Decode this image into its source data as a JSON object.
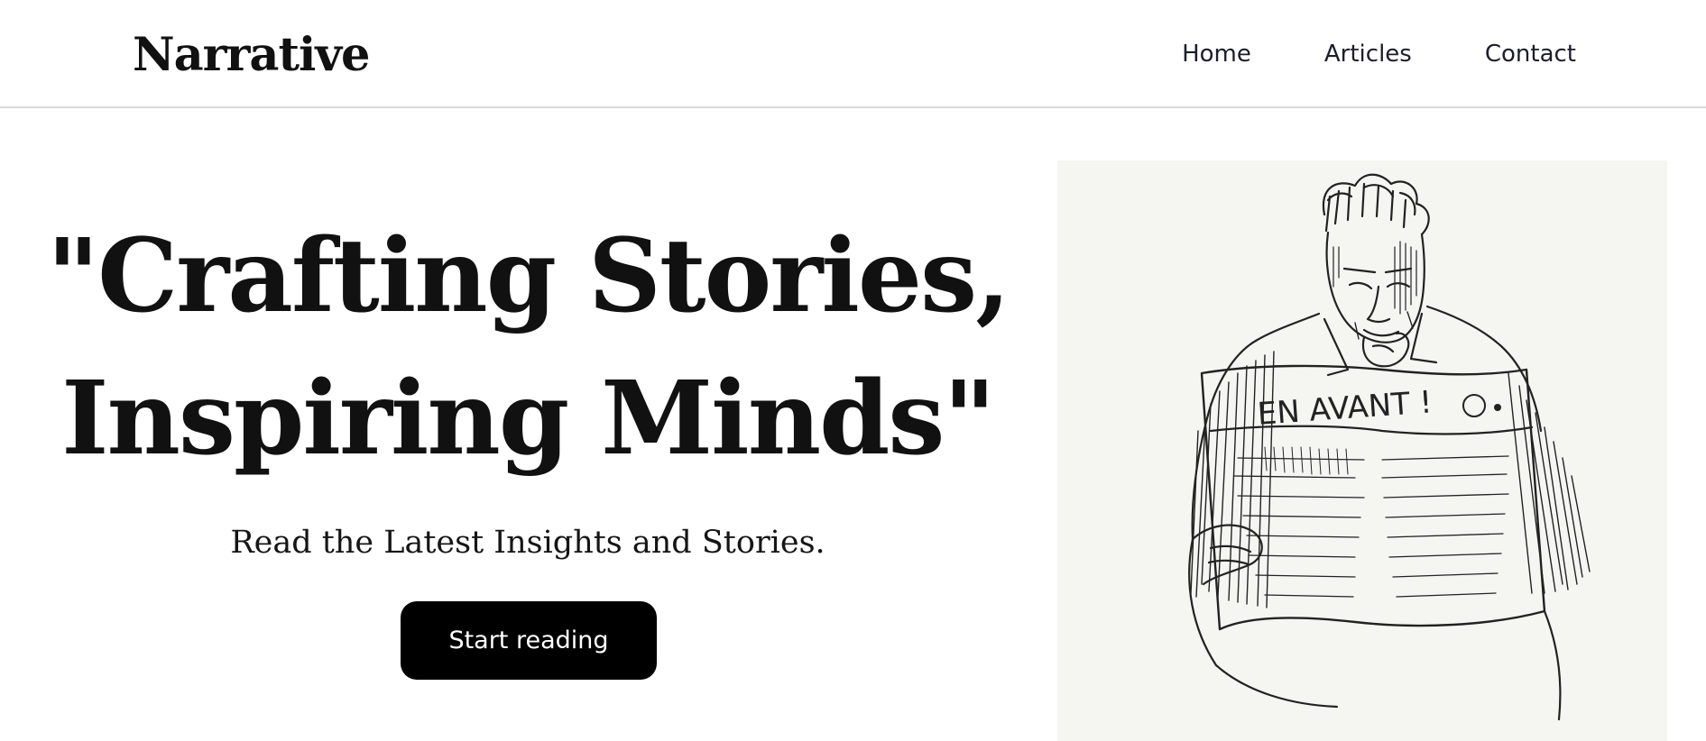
{
  "header": {
    "logo": "Narrative",
    "nav": [
      {
        "label": "Home"
      },
      {
        "label": "Articles"
      },
      {
        "label": "Contact"
      }
    ]
  },
  "hero": {
    "headline_line1": "\"Crafting Stories,",
    "headline_line2": "Inspiring Minds\"",
    "subline": "Read the Latest Insights and Stories.",
    "cta_label": "Start reading",
    "illustration": {
      "description_icon": "man-reading-newspaper-sketch",
      "newspaper_text": "EN AVANT !"
    }
  },
  "colors": {
    "background": "#ffffff",
    "text": "#111111",
    "button_bg": "#000000",
    "button_text": "#ffffff",
    "divider": "#d9d9d9"
  }
}
